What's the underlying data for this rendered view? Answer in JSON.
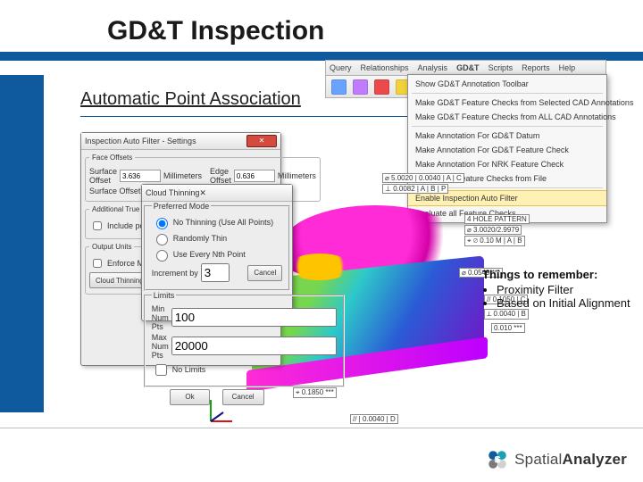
{
  "slide": {
    "title": "GD&T Inspection",
    "subtitle": "Automatic Point Association",
    "brand_prefix": "Spatial",
    "brand_suffix": "Analyzer"
  },
  "notes": {
    "heading": "Things to remember:",
    "items": [
      "Proximity Filter",
      "Based on Initial Alignment"
    ]
  },
  "menu": {
    "items": [
      "Query",
      "Relationships",
      "Analysis",
      "GD&T",
      "Scripts",
      "Reports",
      "Help"
    ],
    "dropdown": [
      "Show GD&T Annotation Toolbar",
      "Make GD&T Feature Checks from Selected CAD Annotations",
      "Make GD&T Feature Checks from ALL CAD Annotations",
      "Make Annotation For GD&T Datum",
      "Make Annotation For GD&T Feature Check",
      "Make Annotation For NRK Feature Check",
      "Make NRK Feature Checks from File",
      "Enable Inspection Auto Filter",
      "Evaluate all Feature Checks"
    ]
  },
  "settings_dialog": {
    "title": "Inspection Auto Filter - Settings",
    "face_offsets_label": "Face Offsets",
    "surface_offset_label": "Surface Offset",
    "surface_offset_value": "3.636",
    "units": "Millimeters",
    "edge_offset_label": "Edge Offset",
    "edge_offset_value": "0.636",
    "surface_offset_dir_label": "Surface Offset Direction",
    "additional_label": "Additional True Position Point",
    "include_points_label": "Include points within",
    "output_units_label": "Output Units",
    "enforce_max_label": "Enforce Max Pts per",
    "thinning_btn": "Cloud Thinning Options..."
  },
  "cloud_thinning": {
    "title": "Cloud Thinning",
    "preferred_mode_label": "Preferred Mode",
    "radios": [
      "No Thinning (Use All Points)",
      "Randomly Thin",
      "Use Every Nth Point"
    ],
    "increment_label": "Increment by",
    "increment_value": "3",
    "cancel": "Cancel",
    "limits_label": "Limits",
    "min_label": "Min Num Pts",
    "min_value": "100",
    "max_label": "Max Num Pts",
    "max_value": "20000",
    "no_limits_label": "No Limits",
    "ok": "Ok",
    "cancel2": "Cancel"
  },
  "callouts": {
    "c1": "⌀ 5.0020 | 0.0040 | A | C",
    "c2": "⊥ 0.0082 | A | B | P",
    "c3": "4 HOLE PATTERN",
    "c4": "⌀ 3.0020/2.9979",
    "c5": "⌖ ⌀ 0.10 M | A | B",
    "c6": "⌀ 0.0549 ***",
    "c7": "// 0.1050 | C",
    "c8": "⟂ 0.0040 | B",
    "c9": "0.010 ***",
    "c10": "⌖ 0.1850 ***",
    "c11": "// | 0.0040 | D"
  },
  "icon_colors": [
    "#6aa3ff",
    "#c07cff",
    "#ea4a4a",
    "#f2d23a",
    "#6ad06a",
    "#8aa0b0",
    "#222"
  ]
}
